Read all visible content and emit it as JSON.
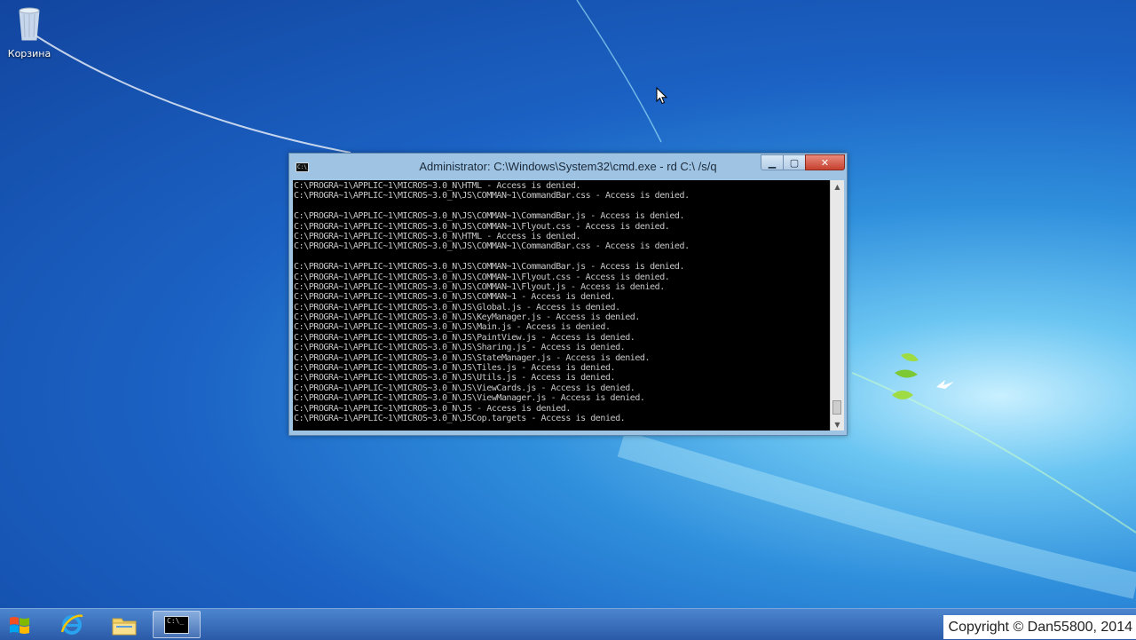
{
  "desktop": {
    "recycle_bin_label": "Корзина"
  },
  "cmd_window": {
    "title": "Administrator: C:\\Windows\\System32\\cmd.exe - rd  C:\\ /s/q",
    "app_icon_text": "C:\\_",
    "lines": [
      "C:\\PROGRA~1\\APPLIC~1\\MICROS~3.0_N\\HTML - Access is denied.",
      "C:\\PROGRA~1\\APPLIC~1\\MICROS~3.0_N\\JS\\COMMAN~1\\CommandBar.css - Access is denied.",
      "",
      "C:\\PROGRA~1\\APPLIC~1\\MICROS~3.0_N\\JS\\COMMAN~1\\CommandBar.js - Access is denied.",
      "C:\\PROGRA~1\\APPLIC~1\\MICROS~3.0_N\\JS\\COMMAN~1\\Flyout.css - Access is denied.",
      "C:\\PROGRA~1\\APPLIC~1\\MICROS~3.0_N\\HTML - Access is denied.",
      "C:\\PROGRA~1\\APPLIC~1\\MICROS~3.0_N\\JS\\COMMAN~1\\CommandBar.css - Access is denied.",
      "",
      "C:\\PROGRA~1\\APPLIC~1\\MICROS~3.0_N\\JS\\COMMAN~1\\CommandBar.js - Access is denied.",
      "C:\\PROGRA~1\\APPLIC~1\\MICROS~3.0_N\\JS\\COMMAN~1\\Flyout.css - Access is denied.",
      "C:\\PROGRA~1\\APPLIC~1\\MICROS~3.0_N\\JS\\COMMAN~1\\Flyout.js - Access is denied.",
      "C:\\PROGRA~1\\APPLIC~1\\MICROS~3.0_N\\JS\\COMMAN~1 - Access is denied.",
      "C:\\PROGRA~1\\APPLIC~1\\MICROS~3.0_N\\JS\\Global.js - Access is denied.",
      "C:\\PROGRA~1\\APPLIC~1\\MICROS~3.0_N\\JS\\KeyManager.js - Access is denied.",
      "C:\\PROGRA~1\\APPLIC~1\\MICROS~3.0_N\\JS\\Main.js - Access is denied.",
      "C:\\PROGRA~1\\APPLIC~1\\MICROS~3.0_N\\JS\\PaintView.js - Access is denied.",
      "C:\\PROGRA~1\\APPLIC~1\\MICROS~3.0_N\\JS\\Sharing.js - Access is denied.",
      "C:\\PROGRA~1\\APPLIC~1\\MICROS~3.0_N\\JS\\StateManager.js - Access is denied.",
      "C:\\PROGRA~1\\APPLIC~1\\MICROS~3.0_N\\JS\\Tiles.js - Access is denied.",
      "C:\\PROGRA~1\\APPLIC~1\\MICROS~3.0_N\\JS\\Utils.js - Access is denied.",
      "C:\\PROGRA~1\\APPLIC~1\\MICROS~3.0_N\\JS\\ViewCards.js - Access is denied.",
      "C:\\PROGRA~1\\APPLIC~1\\MICROS~3.0_N\\JS\\ViewManager.js - Access is denied.",
      "C:\\PROGRA~1\\APPLIC~1\\MICROS~3.0_N\\JS - Access is denied.",
      "C:\\PROGRA~1\\APPLIC~1\\MICROS~3.0_N\\JSCop.targets - Access is denied."
    ]
  },
  "taskbar": {
    "start_icon": "windows-logo-icon",
    "pinned": [
      "internet-explorer-icon",
      "file-explorer-icon",
      "command-prompt-icon"
    ],
    "cmd_icon_text": "C:\\_"
  },
  "watermark": {
    "copyright": "Copyright © Dan55800, 2014"
  },
  "colors": {
    "console_bg": "#000000",
    "console_text": "#c8c8c8",
    "close_button": "#c7412f"
  }
}
